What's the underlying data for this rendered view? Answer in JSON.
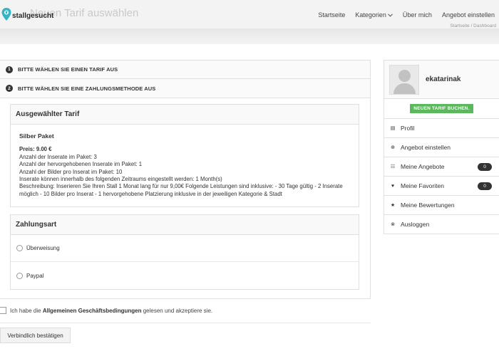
{
  "header": {
    "logo_text": "stallgesucht",
    "ghost_title": "Neuen Tarif auswählen",
    "nav": [
      {
        "label": "Startseite",
        "dropdown": false
      },
      {
        "label": "Kategorien",
        "dropdown": true
      },
      {
        "label": "Über mich",
        "dropdown": false
      },
      {
        "label": "Angebot einstellen",
        "dropdown": false
      }
    ],
    "breadcrumb": "Startseite / Dashboard"
  },
  "steps": [
    {
      "num": "1",
      "label": "BITTE WÄHLEN SIE EINEN TARIF AUS"
    },
    {
      "num": "2",
      "label": "BITTE WÄHLEN SIE EINE ZAHLUNGSMETHODE AUS"
    }
  ],
  "tarif": {
    "heading": "Ausgewählter Tarif",
    "name": "Silber Paket",
    "price": "Preis: 9.00 €",
    "lines": [
      "Anzahl der Inserate im Paket: 3",
      "Anzahl der hervorgehobenen Inserate im Paket: 1",
      "Anzahl der Bilder pro Inserat im Paket: 10",
      "Inserate können innerhalb des folgenden Zeitraums eingestellt werden: 1 Month(s)",
      "Beschreibung: Inserieren Sie Ihren Stall 1 Monat lang für nur 9,00€ Folgende Leistungen sind inklusive: - 30 Tage gültig - 2 Inserate möglich - 10 Bilder pro Inserat - 1 hervorgehobene Platzierung inklusive in der jeweiligen Kategorie & Stadt"
    ]
  },
  "payment": {
    "heading": "Zahlungsart",
    "options": [
      "Überweisung",
      "Paypal"
    ]
  },
  "agb": {
    "before": "Ich habe die ",
    "bold": "Allgemeinen Geschäftsbedingungen",
    "after": " gelesen und akzeptiere sie."
  },
  "confirm_button": "Verbindlich bestätigen",
  "sidebar": {
    "username": "ekatarinak",
    "new_tarif": "NEUEN TARIF BUCHEN.",
    "items": [
      {
        "label": "Profil",
        "icon": "document-icon",
        "glyph": "▤",
        "badge": null
      },
      {
        "label": "Angebot einstellen",
        "icon": "plus-circle-icon",
        "glyph": "⊕",
        "badge": null
      },
      {
        "label": "Meine Angebote",
        "icon": "list-icon",
        "glyph": "☷",
        "badge": "0"
      },
      {
        "label": "Meine Favoriten",
        "icon": "heart-icon",
        "glyph": "♥",
        "badge": "0"
      },
      {
        "label": "Meine Bewertungen",
        "icon": "star-icon",
        "glyph": "★",
        "badge": null
      },
      {
        "label": "Ausloggen",
        "icon": "close-circle-icon",
        "glyph": "⊗",
        "badge": null
      }
    ]
  },
  "colors": {
    "accent_green": "#5cb85c",
    "logo_teal": "#36b4c4",
    "badge_dark": "#333333"
  }
}
